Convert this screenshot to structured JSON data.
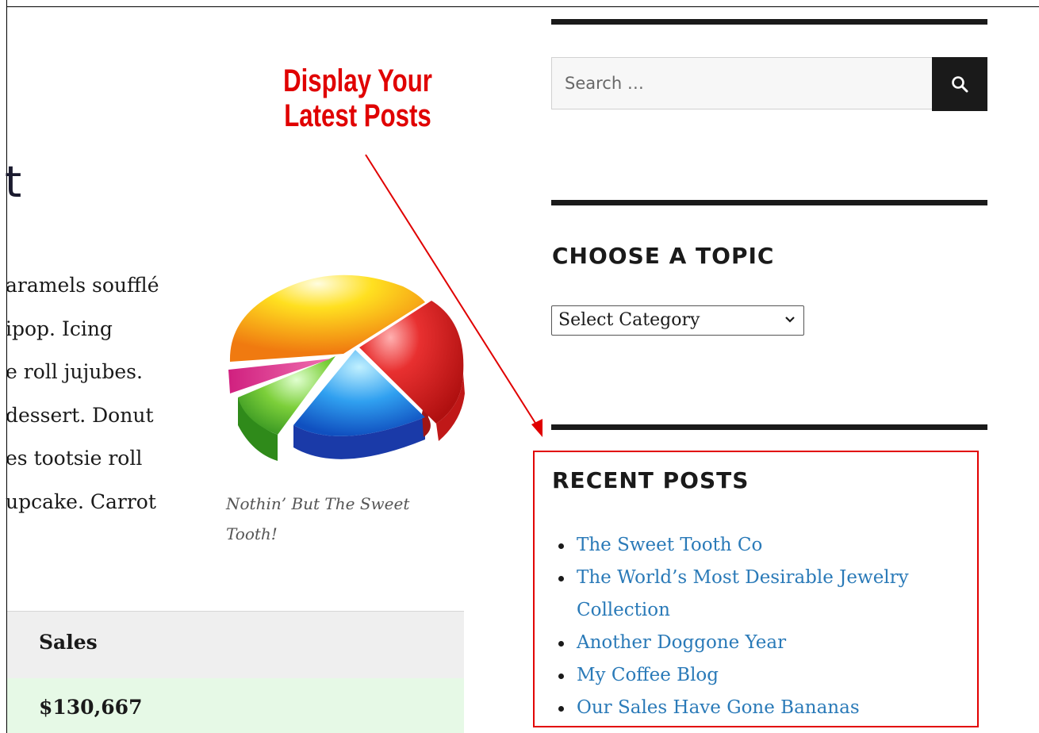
{
  "annotation": {
    "line1": "Display Your",
    "line2": "Latest Posts",
    "color": "#e00000"
  },
  "post": {
    "heading_fragment": "t",
    "paragraph_lines": [
      "aramels soufflé",
      "ipop. Icing",
      "e roll jujubes.",
      "dessert. Donut",
      "es tootsie roll",
      "upcake. Carrot"
    ],
    "image_caption": "Nothin’ But The Sweet Tooth!"
  },
  "table": {
    "header": "Sales",
    "first_value": "$130,667"
  },
  "sidebar": {
    "search": {
      "placeholder": "Search …",
      "icon": "search-icon"
    },
    "topic": {
      "title": "CHOOSE A TOPIC",
      "select_value": "Select Category"
    },
    "recent": {
      "title": "RECENT POSTS",
      "posts": [
        "The Sweet Tooth Co",
        "The World’s Most Desirable Jewelry Collection",
        "Another Doggone Year",
        "My Coffee Blog",
        "Our Sales Have Gone Bananas"
      ]
    }
  },
  "colors": {
    "link": "#2a7ab8",
    "highlight_border": "#e20000",
    "table_header_bg": "#efefef",
    "table_row_bg": "#e6f9e6"
  }
}
